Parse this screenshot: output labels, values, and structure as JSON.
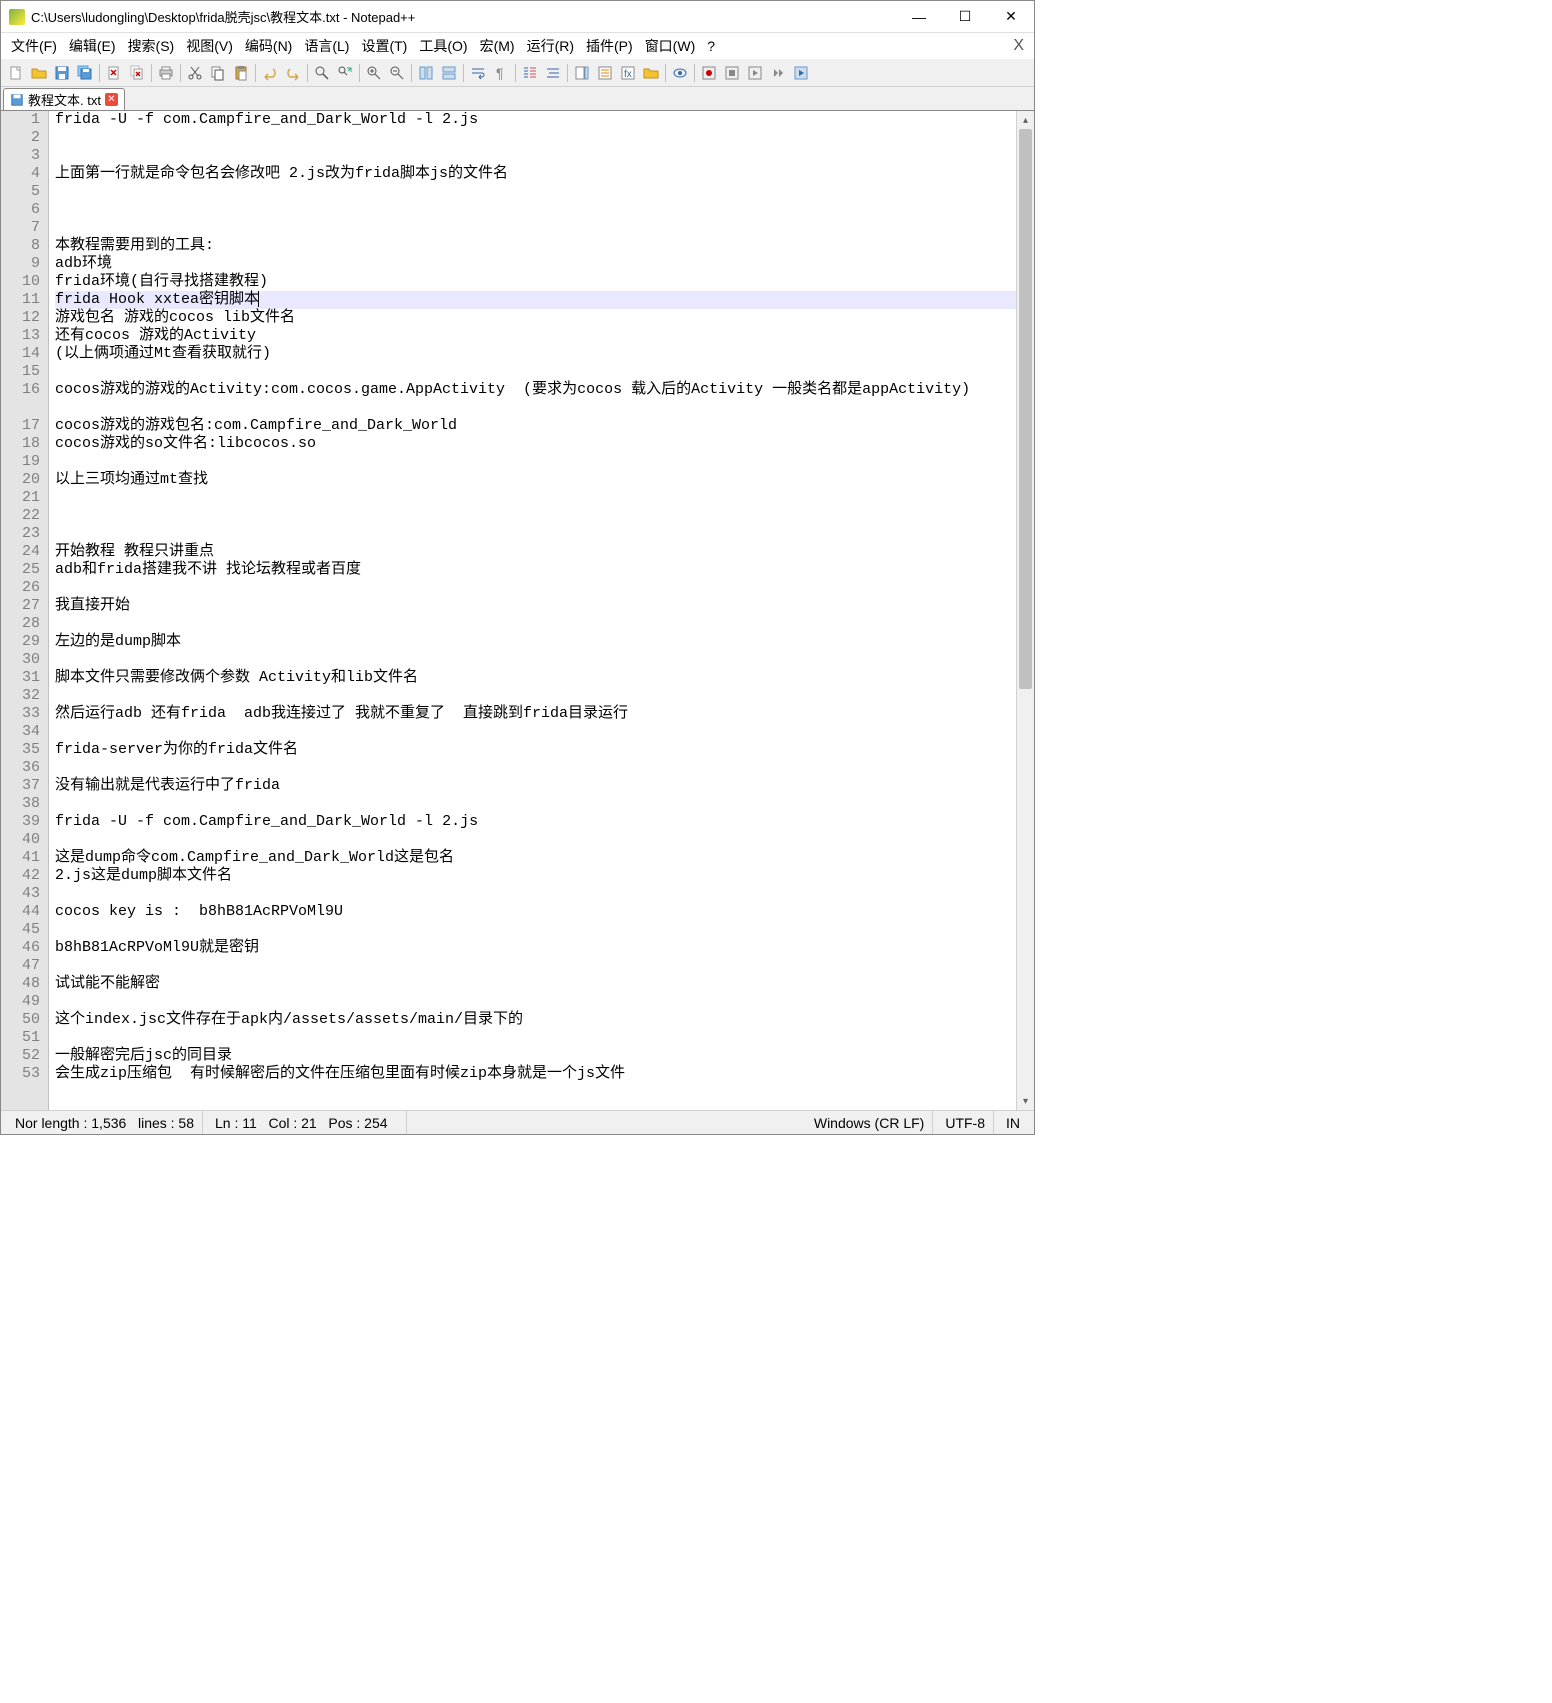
{
  "titlebar": {
    "title": "C:\\Users\\ludongling\\Desktop\\frida脱壳jsc\\教程文本.txt - Notepad++"
  },
  "menubar": {
    "items": [
      "文件(F)",
      "编辑(E)",
      "搜索(S)",
      "视图(V)",
      "编码(N)",
      "语言(L)",
      "设置(T)",
      "工具(O)",
      "宏(M)",
      "运行(R)",
      "插件(P)",
      "窗口(W)",
      "?"
    ],
    "close_x": "X"
  },
  "tab": {
    "label": "教程文本. txt"
  },
  "editor": {
    "current_line": 11,
    "lines": [
      "frida -U -f com.Campfire_and_Dark_World -l 2.js",
      "",
      "",
      "上面第一行就是命令包名会修改吧 2.js改为frida脚本js的文件名",
      "",
      "",
      "",
      "本教程需要用到的工具:",
      "adb环境",
      "frida环境(自行寻找搭建教程)",
      "frida Hook xxtea密钥脚本",
      "游戏包名 游戏的cocos lib文件名",
      "还有cocos 游戏的Activity",
      "(以上俩项通过Mt查看获取就行)",
      "",
      "cocos游戏的游戏的Activity:com.cocos.game.AppActivity  (要求为cocos 载入后的Activity 一般类名都是appActivity)",
      "cocos游戏的游戏包名:com.Campfire_and_Dark_World",
      "cocos游戏的so文件名:libcocos.so",
      "",
      "以上三项均通过mt查找",
      "",
      "",
      "",
      "开始教程 教程只讲重点",
      "adb和frida搭建我不讲 找论坛教程或者百度",
      "",
      "我直接开始",
      "",
      "左边的是dump脚本",
      "",
      "脚本文件只需要修改俩个参数 Activity和lib文件名",
      "",
      "然后运行adb 还有frida  adb我连接过了 我就不重复了  直接跳到frida目录运行",
      "",
      "frida-server为你的frida文件名",
      "",
      "没有输出就是代表运行中了frida",
      "",
      "frida -U -f com.Campfire_and_Dark_World -l 2.js",
      "",
      "这是dump命令com.Campfire_and_Dark_World这是包名",
      "2.js这是dump脚本文件名",
      "",
      "cocos key is :  b8hB81AcRPVoMl9U",
      "",
      "b8hB81AcRPVoMl9U就是密钥",
      "",
      "试试能不能解密",
      "",
      "这个index.jsc文件存在于apk内/assets/assets/main/目录下的",
      "",
      "一般解密完后jsc的同目录",
      "会生成zip压缩包  有时候解密后的文件在压缩包里面有时候zip本身就是一个js文件"
    ]
  },
  "statusbar": {
    "length_label": "Nor length : 1,536",
    "lines_label": "lines : 58",
    "ln_label": "Ln : 11",
    "col_label": "Col : 21",
    "pos_label": "Pos : 254",
    "eol_label": "Windows (CR LF)",
    "enc_label": "UTF-8",
    "ins_label": "IN"
  },
  "icons": {
    "minimize": "—",
    "maximize": "☐",
    "close": "✕"
  }
}
